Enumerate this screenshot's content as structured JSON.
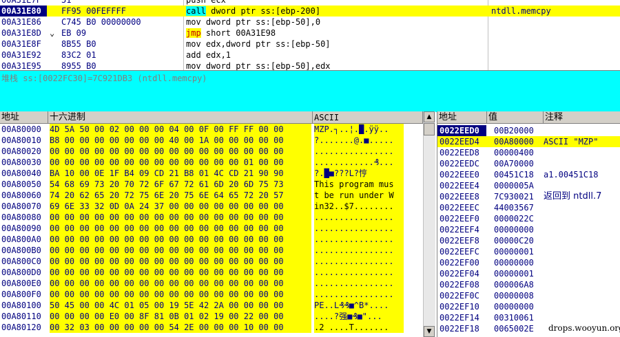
{
  "disasm": {
    "rows": [
      {
        "addr": "00A31E7F",
        "mark": "",
        "hex": "51",
        "asm": "push ecx",
        "comment": ""
      },
      {
        "addr": "00A31E80",
        "mark": "",
        "hex": "FF95 00FEFFFF",
        "kw": "call",
        "rest": " dword ptr ss:[ebp-200]",
        "comment": "ntdll.memcpy",
        "current": true
      },
      {
        "addr": "00A31E86",
        "mark": "",
        "hex": "C745 B0 00000000",
        "asm": "mov dword ptr ss:[ebp-50],0",
        "comment": ""
      },
      {
        "addr": "00A31E8D",
        "mark": "⌄",
        "hex": "EB 09",
        "kw": "jmp",
        "rest": " short 00A31E98",
        "comment": ""
      },
      {
        "addr": "00A31E8F",
        "mark": "",
        "hex": "8B55 B0",
        "asm": "mov edx,dword ptr ss:[ebp-50]",
        "comment": ""
      },
      {
        "addr": "00A31E92",
        "mark": "",
        "hex": "83C2 01",
        "asm": "add edx,1",
        "comment": ""
      },
      {
        "addr": "00A31E95",
        "mark": "",
        "hex": "8955 B0",
        "asm": "mov dword ptr ss:[ebp-50],edx",
        "comment": ""
      }
    ]
  },
  "info": {
    "text": "堆栈 ss:[0022FC30]=7C921DB3 (ntdll.memcpy)"
  },
  "dump": {
    "headers": {
      "addr": "地址",
      "hex": "十六进制",
      "ascii": "ASCII"
    },
    "rows": [
      {
        "addr": "00A80000",
        "hex": "4D 5A 50 00 02 00 00 00 04 00 0F 00 FF FF 00 00",
        "ascii": "MZP.┐..¦.█.ÿÿ.."
      },
      {
        "addr": "00A80010",
        "hex": "B8 00 00 00 00 00 00 00 40 00 1A 00 00 00 00 00",
        "ascii": "?.......@.■....."
      },
      {
        "addr": "00A80020",
        "hex": "00 00 00 00 00 00 00 00 00 00 00 00 00 00 00 00",
        "ascii": "................"
      },
      {
        "addr": "00A80030",
        "hex": "00 00 00 00 00 00 00 00 00 00 00 00 00 01 00 00",
        "ascii": "............₰..."
      },
      {
        "addr": "00A80040",
        "hex": "BA 10 00 0E 1F B4 09 CD 21 B8 01 4C CD 21 90 90",
        "ascii": "?.█■???L?悙"
      },
      {
        "addr": "00A80050",
        "hex": "54 68 69 73 20 70 72 6F 67 72 61 6D 20 6D 75 73",
        "ascii": "This program mus",
        "txt": true
      },
      {
        "addr": "00A80060",
        "hex": "74 20 62 65 20 72 75 6E 20 75 6E 64 65 72 20 57",
        "ascii": "t be run under W",
        "txt": true
      },
      {
        "addr": "00A80070",
        "hex": "69 6E 33 32 0D 0A 24 37 00 00 00 00 00 00 00 00",
        "ascii": "in32..$7........",
        "txt": true
      },
      {
        "addr": "00A80080",
        "hex": "00 00 00 00 00 00 00 00 00 00 00 00 00 00 00 00",
        "ascii": "................"
      },
      {
        "addr": "00A80090",
        "hex": "00 00 00 00 00 00 00 00 00 00 00 00 00 00 00 00",
        "ascii": "................"
      },
      {
        "addr": "00A800A0",
        "hex": "00 00 00 00 00 00 00 00 00 00 00 00 00 00 00 00",
        "ascii": "................"
      },
      {
        "addr": "00A800B0",
        "hex": "00 00 00 00 00 00 00 00 00 00 00 00 00 00 00 00",
        "ascii": "................"
      },
      {
        "addr": "00A800C0",
        "hex": "00 00 00 00 00 00 00 00 00 00 00 00 00 00 00 00",
        "ascii": "................"
      },
      {
        "addr": "00A800D0",
        "hex": "00 00 00 00 00 00 00 00 00 00 00 00 00 00 00 00",
        "ascii": "................"
      },
      {
        "addr": "00A800E0",
        "hex": "00 00 00 00 00 00 00 00 00 00 00 00 00 00 00 00",
        "ascii": "................"
      },
      {
        "addr": "00A800F0",
        "hex": "00 00 00 00 00 00 00 00 00 00 00 00 00 00 00 00",
        "ascii": "................"
      },
      {
        "addr": "00A80100",
        "hex": "50 45 00 00 4C 01 05 00 19 5E 42 2A 00 00 00 00",
        "ascii": "PE..L₰₰■^B*...."
      },
      {
        "addr": "00A80110",
        "hex": "00 00 00 00 E0 00 8F 81 0B 01 02 19 00 22 00 00",
        "ascii": "....?强■₰■\"..."
      },
      {
        "addr": "00A80120",
        "hex": "00 32 03 00 00 00 00 00 54 2E 00 00 00 10 00 00",
        "ascii": ".2 ....T.......",
        "txt": true
      }
    ]
  },
  "stack": {
    "headers": {
      "addr": "地址",
      "val": "值",
      "cmt": "注释"
    },
    "rows": [
      {
        "addr": "0022EED0",
        "val": "00B20000",
        "cmt": "",
        "selected": true
      },
      {
        "addr": "0022EED4",
        "val": "00A80000",
        "cmt": "ASCII \"MZP\"",
        "highlight": true
      },
      {
        "addr": "0022EED8",
        "val": "00000400",
        "cmt": ""
      },
      {
        "addr": "0022EEDC",
        "val": "00A70000",
        "cmt": ""
      },
      {
        "addr": "0022EEE0",
        "val": "00451C18",
        "cmt": "a1.00451C18"
      },
      {
        "addr": "0022EEE4",
        "val": "0000005A",
        "cmt": ""
      },
      {
        "addr": "0022EEE8",
        "val": "7C930021",
        "cmt": "返回到 ntdll.7",
        "cn": true
      },
      {
        "addr": "0022EEEC",
        "val": "44003567",
        "cmt": ""
      },
      {
        "addr": "0022EEF0",
        "val": "0000022C",
        "cmt": ""
      },
      {
        "addr": "0022EEF4",
        "val": "00000000",
        "cmt": ""
      },
      {
        "addr": "0022EEF8",
        "val": "00000C20",
        "cmt": ""
      },
      {
        "addr": "0022EEFC",
        "val": "00000001",
        "cmt": ""
      },
      {
        "addr": "0022EF00",
        "val": "00000000",
        "cmt": ""
      },
      {
        "addr": "0022EF04",
        "val": "00000001",
        "cmt": ""
      },
      {
        "addr": "0022EF08",
        "val": "000006A8",
        "cmt": ""
      },
      {
        "addr": "0022EF0C",
        "val": "00000008",
        "cmt": ""
      },
      {
        "addr": "0022EF10",
        "val": "00000000",
        "cmt": ""
      },
      {
        "addr": "0022EF14",
        "val": "00310061",
        "cmt": ""
      },
      {
        "addr": "0022EF18",
        "val": "0065002E",
        "cmt": ""
      }
    ]
  },
  "scroll": {
    "up": "▲",
    "down": "▼"
  },
  "watermark": "drops.wooyun.org"
}
